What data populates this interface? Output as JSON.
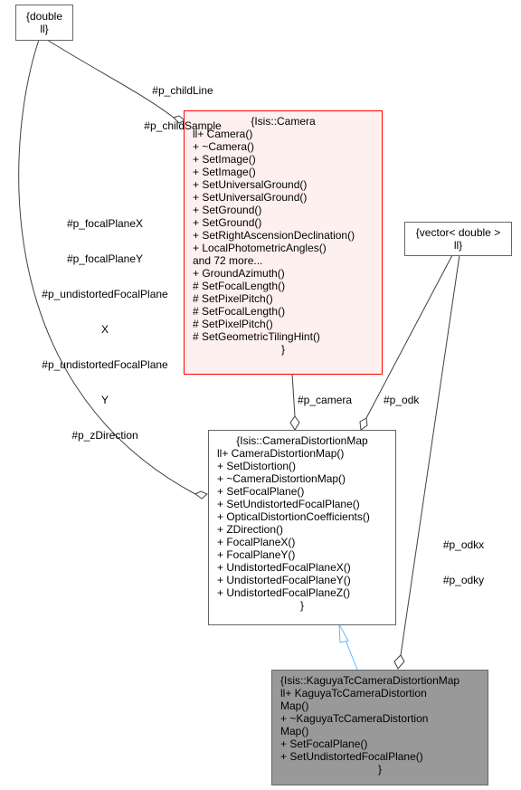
{
  "nodes": {
    "double_ll": {
      "lines": [
        "{double",
        "ll}"
      ]
    },
    "camera": {
      "title": "{Isis::Camera",
      "members": [
        "ll+ Camera()",
        "+ ~Camera()",
        "+ SetImage()",
        "+ SetImage()",
        "+ SetUniversalGround()",
        "+ SetUniversalGround()",
        "+ SetGround()",
        "+ SetGround()",
        "+ SetRightAscensionDeclination()",
        "+ LocalPhotometricAngles()",
        "and 72 more...",
        "+ GroundAzimuth()",
        "# SetFocalLength()",
        "# SetPixelPitch()",
        "# SetFocalLength()",
        "# SetPixelPitch()",
        "# SetGeometricTilingHint()"
      ],
      "close": "}"
    },
    "vector_double": {
      "lines": [
        "{vector< double >",
        "ll}"
      ]
    },
    "camera_distortion_map": {
      "title": "{Isis::CameraDistortionMap",
      "members": [
        "ll+ CameraDistortionMap()",
        "+ SetDistortion()",
        "+ ~CameraDistortionMap()",
        "+ SetFocalPlane()",
        "+ SetUndistortedFocalPlane()",
        "+ OpticalDistortionCoefficients()",
        "+ ZDirection()",
        "+ FocalPlaneX()",
        "+ FocalPlaneY()",
        "+ UndistortedFocalPlaneX()",
        "+ UndistortedFocalPlaneY()",
        "+ UndistortedFocalPlaneZ()"
      ],
      "close": "}"
    },
    "kaguya": {
      "title": "{Isis::KaguyaTcCameraDistortionMap",
      "members": [
        "ll+ KaguyaTcCameraDistortion",
        "Map()",
        "+ ~KaguyaTcCameraDistortion",
        "Map()",
        "+ SetFocalPlane()",
        "+ SetUndistortedFocalPlane()"
      ],
      "close": "}"
    }
  },
  "edge_labels": {
    "child": [
      "#p_childLine",
      "#p_childSample"
    ],
    "focal": [
      "#p_focalPlaneX",
      "#p_focalPlaneY",
      "#p_undistortedFocalPlane",
      "X",
      "#p_undistortedFocalPlane",
      "Y",
      "#p_zDirection"
    ],
    "camera": "#p_camera",
    "odk": "#p_odk",
    "odkxy": [
      "#p_odkx",
      "#p_odky"
    ]
  },
  "colors": {
    "edge": "#404040",
    "inheritance": "#63b8ff",
    "camera_border": "#ff0000",
    "camera_fill": "#fff0f0",
    "kaguya_fill": "#999999"
  }
}
